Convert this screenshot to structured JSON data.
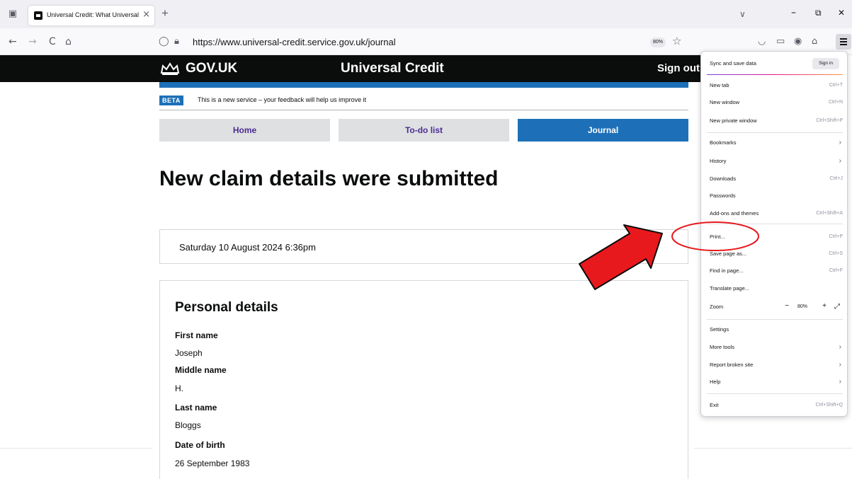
{
  "browser": {
    "tab": {
      "title": "Universal Credit: What Universal",
      "close": "×"
    },
    "new_tab": "+",
    "tab_list": "∨",
    "window": {
      "minimize": "–",
      "restore": "⧉",
      "close": "✕"
    },
    "nav": {
      "back": "←",
      "forward": "→",
      "reload": "C",
      "home": "⌂"
    },
    "url": "https://www.universal-credit.service.gov.uk/journal",
    "zoom_badge": "80%",
    "bookmark_star": "☆"
  },
  "page": {
    "header": {
      "logo_text": "GOV.UK",
      "service_name": "Universal Credit",
      "sign_out": "Sign out"
    },
    "phase_banner": {
      "tag": "BETA",
      "text": "This is a new service – your feedback will help us improve it"
    },
    "nav_tabs": [
      {
        "label": "Home",
        "active": false
      },
      {
        "label": "To-do list",
        "active": false
      },
      {
        "label": "Journal",
        "active": true
      }
    ],
    "title": "New claim details were submitted",
    "timestamp": "Saturday 10 August 2024 6:36pm",
    "personal_details": {
      "heading": "Personal details",
      "fields": [
        {
          "label": "First name",
          "value": "Joseph"
        },
        {
          "label": "Middle name",
          "value": "H."
        },
        {
          "label": "Last name",
          "value": "Bloggs"
        },
        {
          "label": "Date of birth",
          "value": "26 September 1983"
        }
      ]
    }
  },
  "app_menu": {
    "sync_label": "Sync and save data",
    "sign_in": "Sign in",
    "items": [
      {
        "label": "New tab",
        "shortcut": "Ctrl+T"
      },
      {
        "label": "New window",
        "shortcut": "Ctrl+N"
      },
      {
        "label": "New private window",
        "shortcut": "Ctrl+Shift+P"
      },
      {
        "label": "Bookmarks",
        "submenu": true
      },
      {
        "label": "History",
        "submenu": true
      },
      {
        "label": "Downloads",
        "shortcut": "Ctrl+J"
      },
      {
        "label": "Passwords"
      },
      {
        "label": "Add-ons and themes",
        "shortcut": "Ctrl+Shift+A"
      },
      {
        "label": "Print...",
        "shortcut": "Ctrl+P"
      },
      {
        "label": "Save page as...",
        "shortcut": "Ctrl+S"
      },
      {
        "label": "Find in page...",
        "shortcut": "Ctrl+F"
      },
      {
        "label": "Translate page..."
      },
      {
        "label": "Settings"
      },
      {
        "label": "More tools",
        "submenu": true
      },
      {
        "label": "Report broken site",
        "submenu": true
      },
      {
        "label": "Help",
        "submenu": true
      },
      {
        "label": "Exit",
        "shortcut": "Ctrl+Shift+Q"
      }
    ],
    "zoom": {
      "label": "Zoom",
      "minus": "−",
      "value": "80%",
      "plus": "+",
      "fullscreen": "⤢"
    },
    "chevron": "›"
  },
  "colors": {
    "gov_black": "#0b0c0c",
    "gov_blue": "#1d70b8",
    "link_purple": "#4c2c92",
    "annotation_red": "#e8191d"
  }
}
